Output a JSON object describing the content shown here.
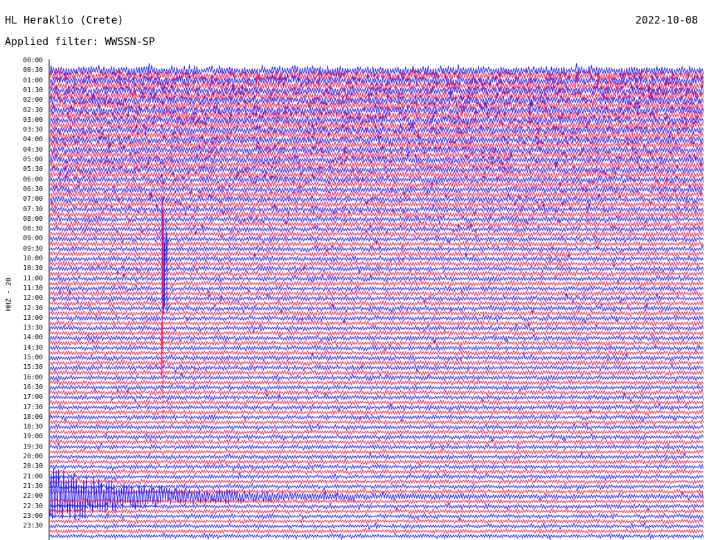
{
  "header": {
    "station": "HL Heraklio (Crete)",
    "date": "2022-10-08",
    "filter": "Applied filter: WWSSN-SP",
    "channel": "HHZ - 20"
  },
  "colors": {
    "trace_a": "#1a1aff",
    "trace_b": "#ff1a4a",
    "axis": "#000000"
  },
  "chart_data": {
    "type": "line",
    "title": "HL Heraklio (Crete)",
    "ylabel": "HHZ - 20",
    "y_tick_labels": [
      "00:00",
      "00:30",
      "01:00",
      "01:30",
      "02:00",
      "02:30",
      "03:00",
      "03:30",
      "04:00",
      "04:30",
      "05:00",
      "05:30",
      "06:00",
      "06:30",
      "07:00",
      "07:30",
      "08:00",
      "08:30",
      "09:00",
      "09:30",
      "10:00",
      "10:30",
      "11:00",
      "11:30",
      "12:00",
      "12:30",
      "13:00",
      "13:30",
      "14:00",
      "14:30",
      "15:00",
      "15:30",
      "16:00",
      "16:30",
      "17:00",
      "17:30",
      "18:00",
      "18:30",
      "19:00",
      "19:30",
      "20:00",
      "20:30",
      "21:00",
      "21:30",
      "22:00",
      "22:30",
      "23:00",
      "23:30"
    ],
    "traces_start": "00:30",
    "trace_duration_minutes": 15,
    "trace_colors_alternate": [
      "blue",
      "red"
    ],
    "event": {
      "origin_time": "22:00",
      "description": "large amplitude earthquake signal with ring-down coda"
    },
    "grid": false,
    "legend": "none"
  }
}
